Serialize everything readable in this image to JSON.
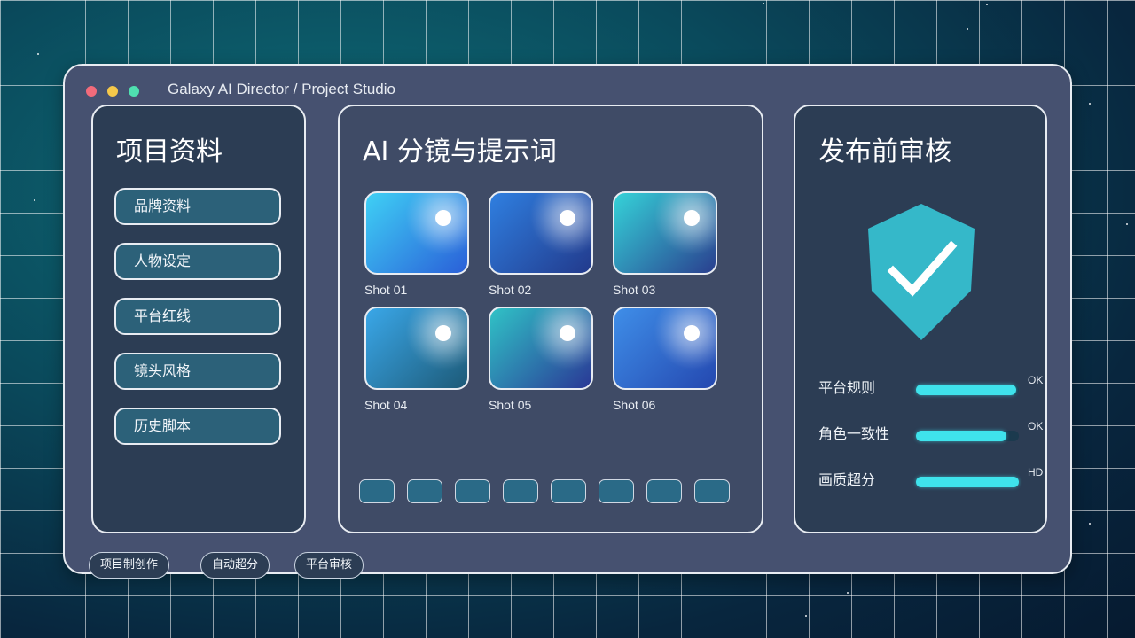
{
  "window": {
    "title": "Galaxy AI Director / Project Studio"
  },
  "left_panel": {
    "title": "项目资料",
    "items": [
      {
        "label": "品牌资料"
      },
      {
        "label": "人物设定"
      },
      {
        "label": "平台红线"
      },
      {
        "label": "镜头风格"
      },
      {
        "label": "历史脚本"
      }
    ]
  },
  "mid_panel": {
    "title": "AI 分镜与提示词",
    "shots": [
      {
        "label": "Shot 01",
        "gradient": [
          "#3fd0f5",
          "#2a5fd8"
        ]
      },
      {
        "label": "Shot 02",
        "gradient": [
          "#2f7fe0",
          "#223a8c"
        ]
      },
      {
        "label": "Shot 03",
        "gradient": [
          "#35d2d8",
          "#2a3f8f"
        ]
      },
      {
        "label": "Shot 04",
        "gradient": [
          "#3aa7e8",
          "#1d5a78"
        ]
      },
      {
        "label": "Shot 05",
        "gradient": [
          "#30c2c6",
          "#2a3896"
        ]
      },
      {
        "label": "Shot 06",
        "gradient": [
          "#3f8ee8",
          "#2448b0"
        ]
      }
    ],
    "timeline_chip_count": 8
  },
  "right_panel": {
    "title": "发布前审核",
    "shield_color": "#35b8c9",
    "checks": [
      {
        "label": "平台规则",
        "progress": 0.97,
        "status": "OK"
      },
      {
        "label": "角色一致性",
        "progress": 0.88,
        "status": "OK"
      },
      {
        "label": "画质超分",
        "progress": 1.0,
        "status": "HD"
      }
    ]
  },
  "footer_tags": [
    {
      "label": "项目制创作"
    },
    {
      "label": "自动超分"
    },
    {
      "label": "平台审核"
    }
  ],
  "colors": {
    "accent_cyan": "#3fe3ec",
    "panel_dark": "#2c3d54",
    "window_bg": "#465170"
  }
}
